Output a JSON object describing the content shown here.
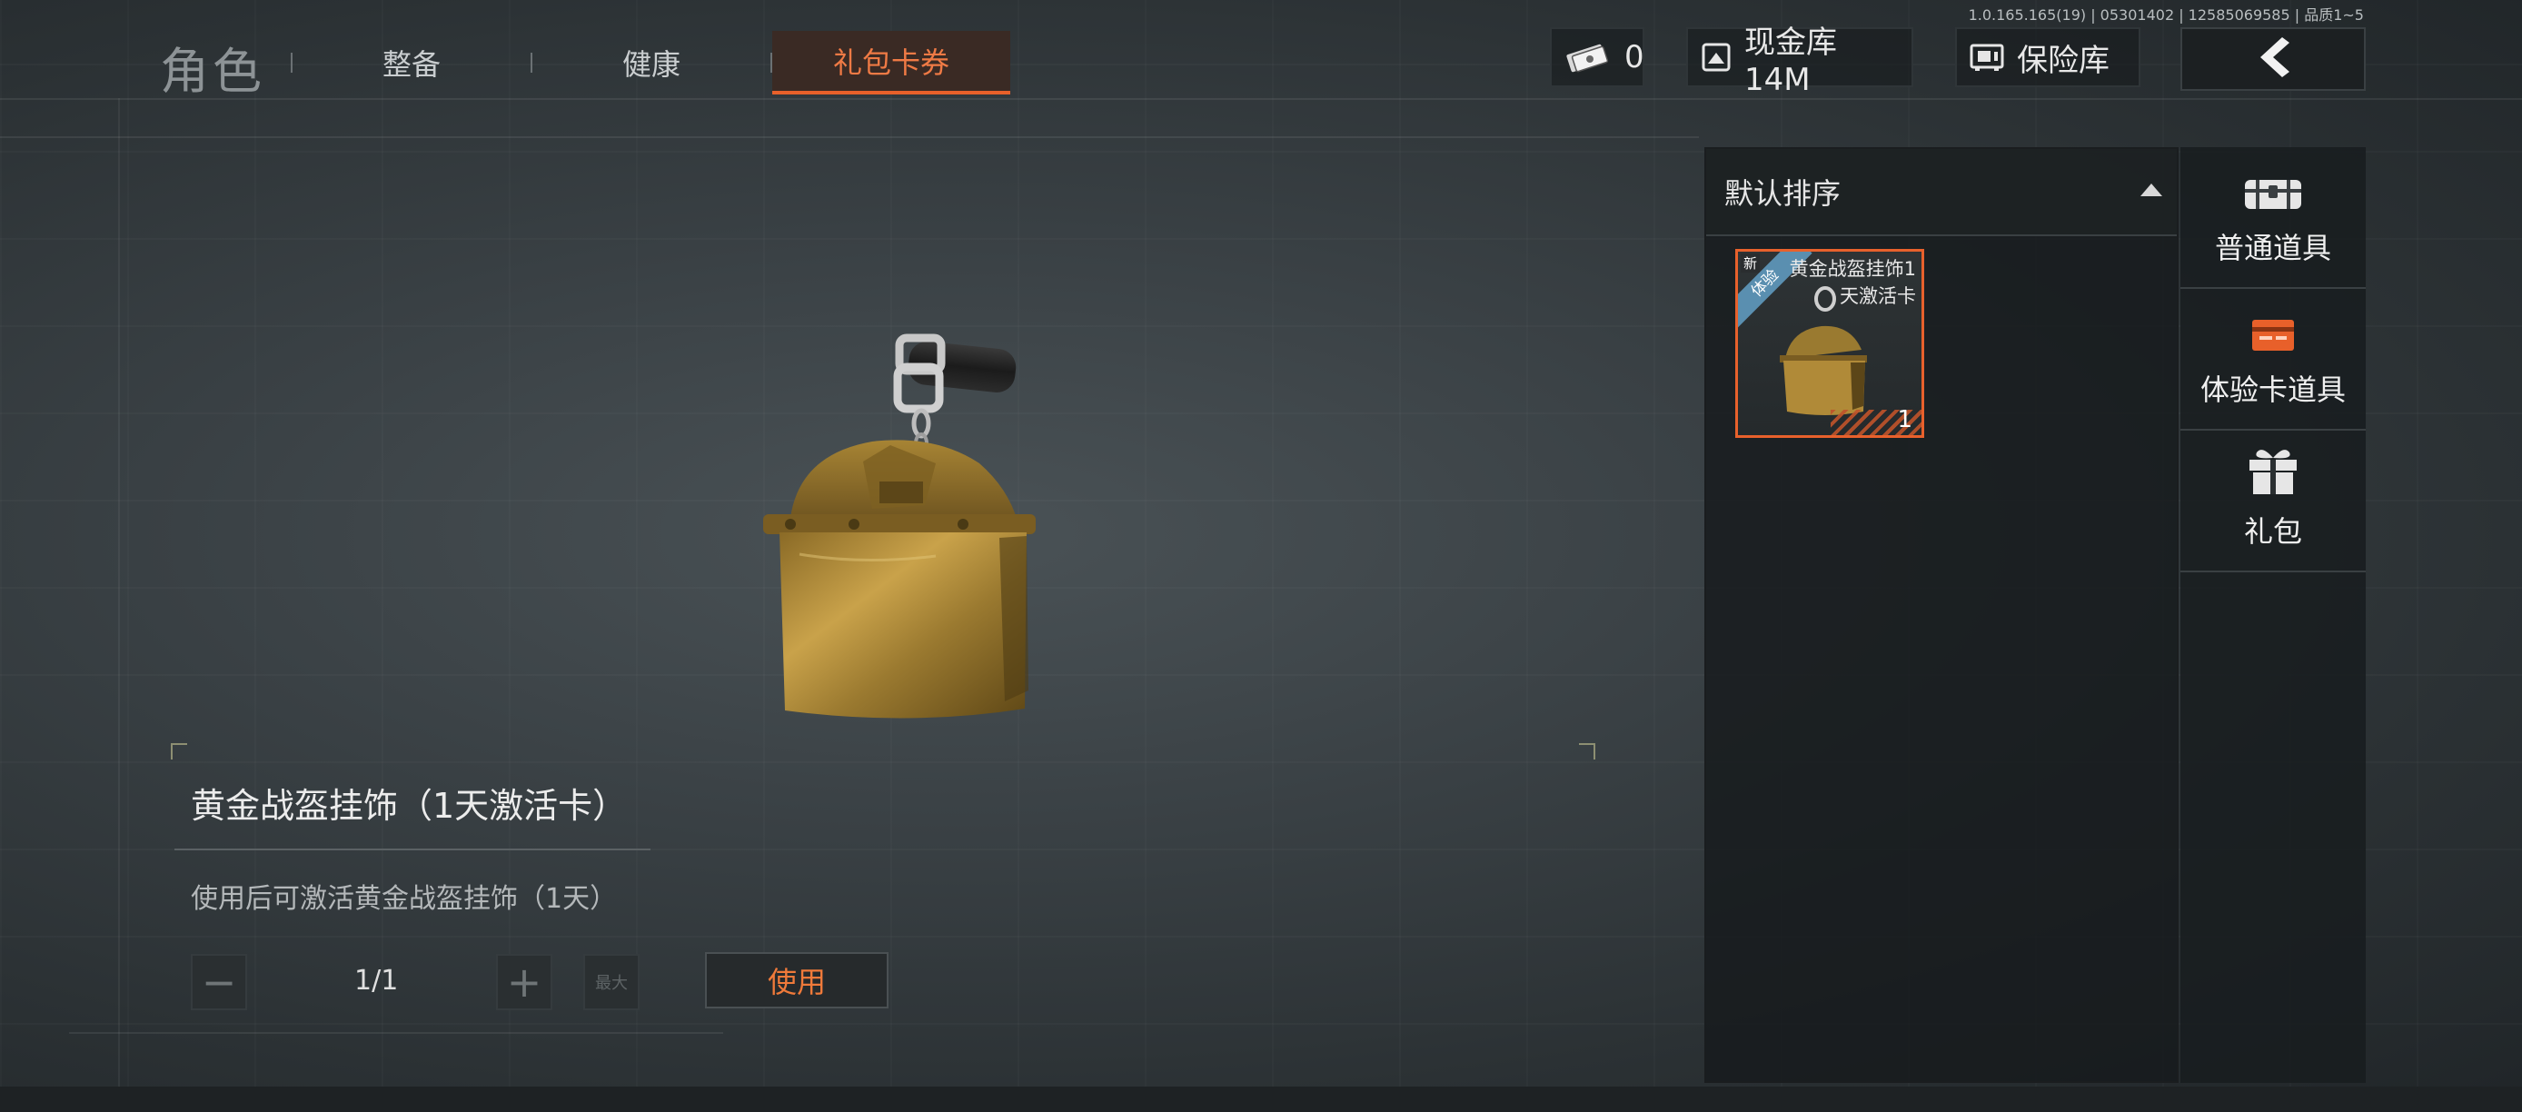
{
  "header": {
    "title": "角色",
    "tabs": [
      {
        "label": "整备",
        "active": false
      },
      {
        "label": "健康",
        "active": false
      },
      {
        "label": "礼包卡券",
        "active": true
      }
    ],
    "version": "1.0.165.165(19) | 05301402 | 12585069585 | 品质1~5",
    "currency_value": "0",
    "cash_vault_label": "现金库 14M",
    "safe_label": "保险库"
  },
  "item": {
    "name": "黄金战盔挂饰（1天激活卡）",
    "description": "使用后可激活黄金战盔挂饰（1天）",
    "quantity": "1/1",
    "minus": "−",
    "plus": "+",
    "max_label": "最大",
    "use_label": "使用"
  },
  "inventory": {
    "sort_label": "默认排序",
    "cards": [
      {
        "name": "黄金战盔挂饰1天激活卡",
        "name_line1": "黄金战盔挂饰1",
        "name_line2": "天激活卡",
        "count": "1",
        "new_badge": "新",
        "ribbon": "体验"
      }
    ]
  },
  "categories": [
    {
      "label": "普通道具",
      "icon": "chest-icon"
    },
    {
      "label": "体验卡道具",
      "icon": "experience-card-icon"
    },
    {
      "label": "礼包",
      "icon": "gift-icon"
    }
  ],
  "colors": {
    "accent": "#e8602a",
    "accent_text": "#ef7a45",
    "panel_bg": "#1a1e20",
    "gold": "#b08a38"
  }
}
